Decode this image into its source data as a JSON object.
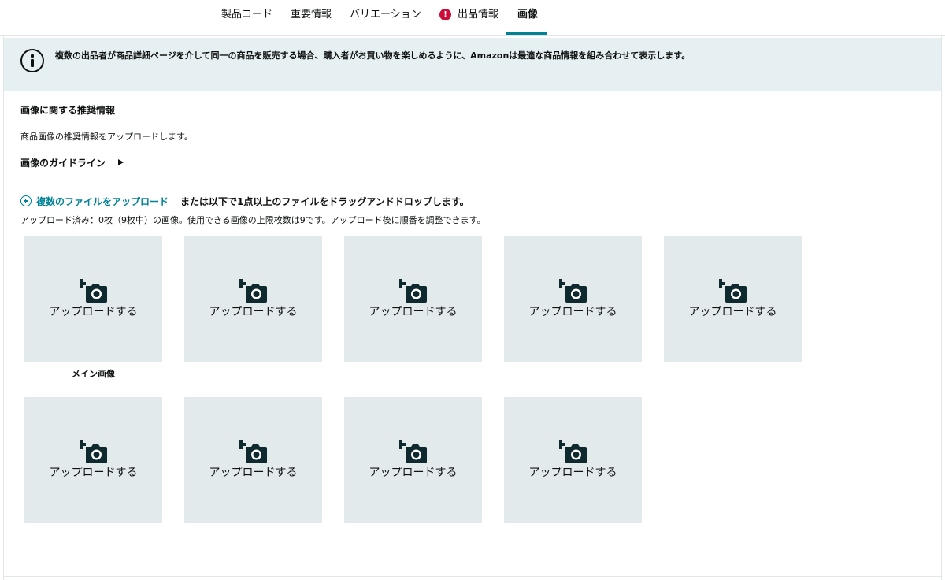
{
  "tabs": {
    "product_code": "製品コード",
    "important_info": "重要情報",
    "variations": "バリエーション",
    "listing_info": "出品情報",
    "images": "画像",
    "alert_symbol": "!"
  },
  "banner": {
    "text": "複数の出品者が商品詳細ページを介して同一の商品を販売する場合、購入者がお買い物を楽しめるように、Amazonは最適な商品情報を組み合わせて表示します。"
  },
  "section": {
    "title": "画像に関する推奨情報",
    "description": "商品画像の推奨情報をアップロードします。",
    "guidelines_link": "画像のガイドライン"
  },
  "upload": {
    "link_label": "複数のファイルをアップロード",
    "drag_text": "または以下で1点以上のファイルをドラッグアンドドロップします。",
    "status": "アップロード済み：0枚（9枚中）の画像。使用できる画像の上限枚数は9です。アップロード後に順番を調整できます。"
  },
  "slots": {
    "label": "アップロードする",
    "count": 9,
    "main_caption": "メイン画像"
  },
  "colors": {
    "accent": "#008296",
    "alert": "#cc0c39",
    "banner_bg": "#e6f0f2",
    "slot_bg": "#e3eaeb",
    "icon": "#0f2a2e"
  },
  "icons": [
    "info-icon",
    "alert-icon",
    "play-caret-icon",
    "plus-circle-icon",
    "camera-add-icon"
  ]
}
